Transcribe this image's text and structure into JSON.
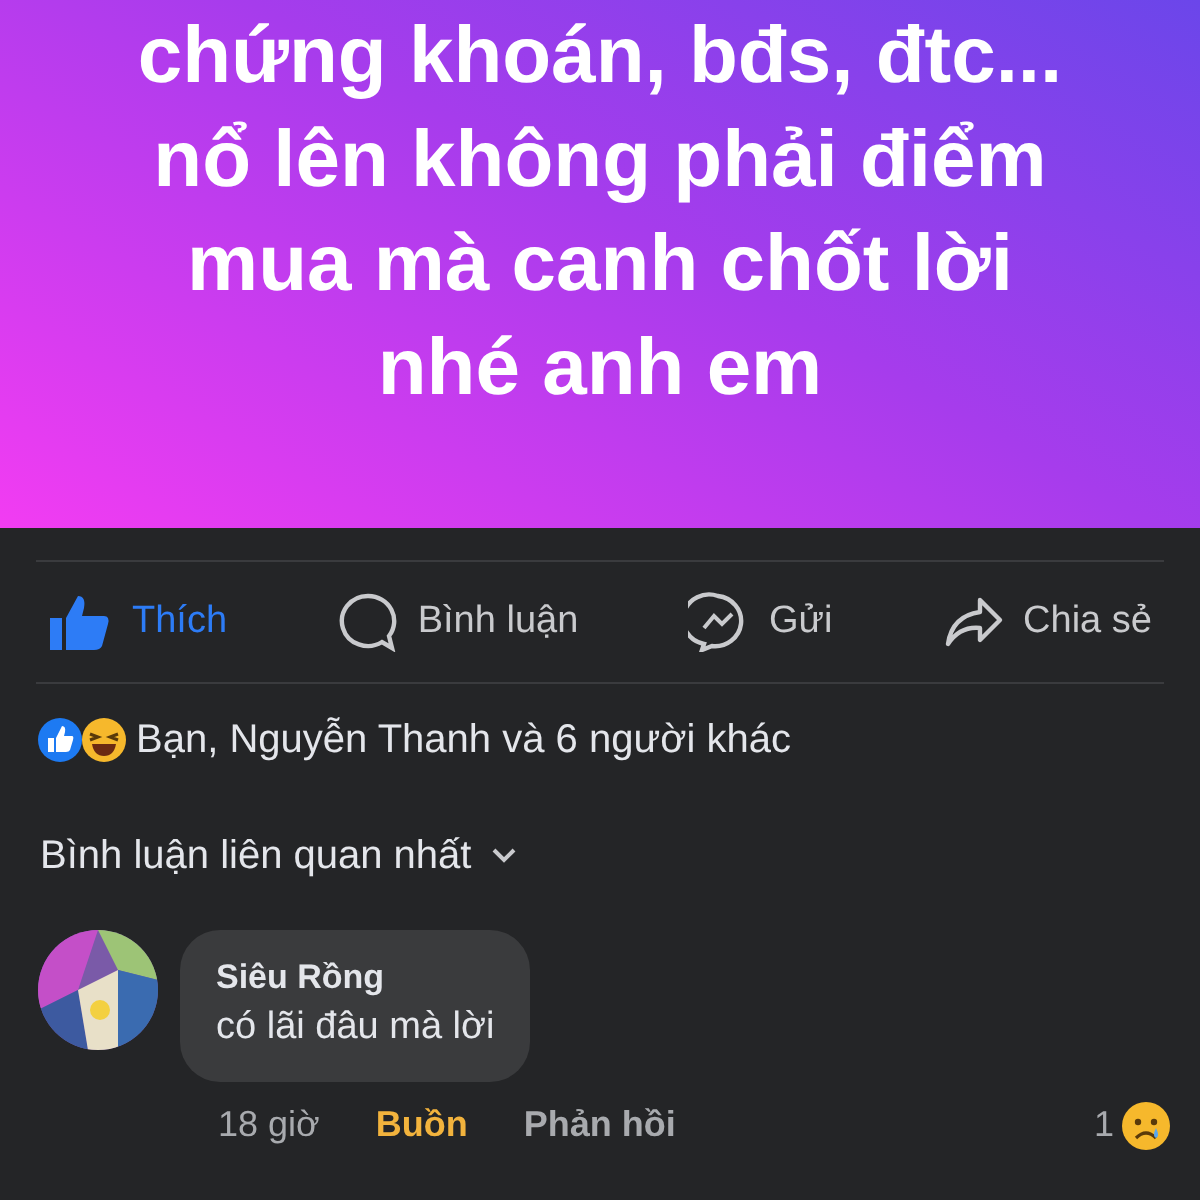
{
  "post_text": [
    "chứng khoán, bđs, đtc...",
    "nổ lên không phải điểm",
    "mua mà canh chốt lời",
    "nhé anh em"
  ],
  "actions": [
    {
      "kind": "like",
      "label": "Thích",
      "selected": true
    },
    {
      "kind": "comment",
      "label": "Bình luận",
      "selected": false
    },
    {
      "kind": "send",
      "label": "Gửi",
      "selected": false
    },
    {
      "kind": "share",
      "label": "Chia sẻ",
      "selected": false
    }
  ],
  "reactions_summary": "Bạn, Nguyễn Thanh và 6 người khác",
  "comment_sort": "Bình luận liên quan nhất",
  "comments": [
    {
      "author": "Siêu Rồng",
      "text": "có lãi đâu mà lời",
      "time": "18 giờ",
      "reaction": "Buồn",
      "reply": "Phản hồi",
      "reaction_count": "1"
    }
  ]
}
